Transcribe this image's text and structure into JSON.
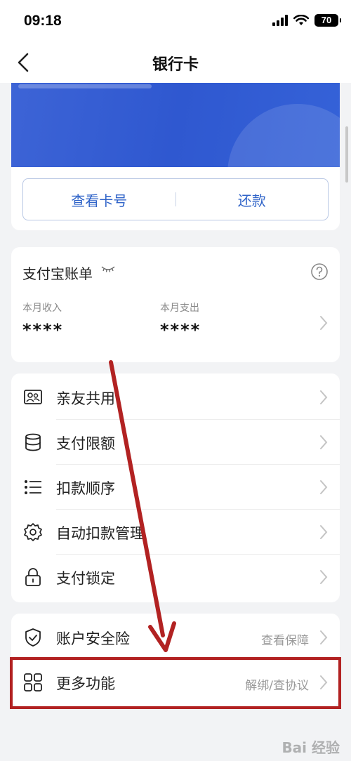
{
  "status_bar": {
    "time": "09:18",
    "battery": "70"
  },
  "nav": {
    "title": "银行卡"
  },
  "card": {
    "view_number": "查看卡号",
    "repay": "还款"
  },
  "bill": {
    "title": "支付宝账单",
    "income_label": "本月收入",
    "income_value": "****",
    "expense_label": "本月支出",
    "expense_value": "****"
  },
  "menu": {
    "items": [
      {
        "label": "亲友共用",
        "icon": "users-card-icon"
      },
      {
        "label": "支付限额",
        "icon": "database-icon"
      },
      {
        "label": "扣款顺序",
        "icon": "list-icon"
      },
      {
        "label": "自动扣款管理",
        "icon": "gear-icon"
      },
      {
        "label": "支付锁定",
        "icon": "lock-icon"
      }
    ]
  },
  "menu2": {
    "items": [
      {
        "label": "账户安全险",
        "right": "查看保障",
        "icon": "shield-icon"
      },
      {
        "label": "更多功能",
        "right": "解绑/查协议",
        "icon": "grid-icon"
      }
    ]
  },
  "colors": {
    "brand_blue": "#2f63c8",
    "annotation_red": "#b22222"
  },
  "watermark": "Bai 经验"
}
